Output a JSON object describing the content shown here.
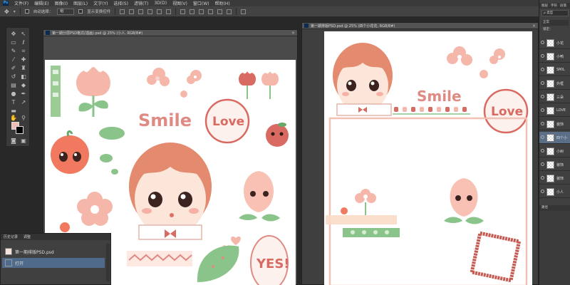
{
  "menubar": {
    "items": [
      "文件(F)",
      "编辑(E)",
      "图像(I)",
      "图层(L)",
      "文字(Y)",
      "选择(S)",
      "滤镜(T)",
      "3D(D)",
      "视图(V)",
      "窗口(W)",
      "帮助(H)"
    ]
  },
  "options": {
    "auto_select_label": "自动选择：",
    "auto_select_value": "组",
    "show_transform_label": "显示变换控件"
  },
  "doc_left": {
    "title": "第一期分层PSD格式(插画).psd @ 25% (小人, RGB/8#)",
    "smile": "Smile",
    "love": "Love",
    "yes": "YES!"
  },
  "doc_right": {
    "title": "第一期排版PSD.psd @ 25% (四个小花花, RGB/8#)",
    "smile": "Smile",
    "love": "Love"
  },
  "history": {
    "tabs": [
      "历史记录",
      "调整"
    ],
    "items": [
      "第一期排版PSD.psd",
      "打开"
    ]
  },
  "layers": {
    "tabs": [
      "图层",
      "字符",
      "段落"
    ],
    "filter_label": "ρ 类型",
    "blend_mode": "正常",
    "lock_label": "锁定：",
    "items": [
      {
        "name": "小花"
      },
      {
        "name": "小鸭"
      },
      {
        "name": "SMIL"
      },
      {
        "name": "外框"
      },
      {
        "name": "三朵"
      },
      {
        "name": "LOVE"
      },
      {
        "name": "装饰"
      },
      {
        "name": "四个小"
      },
      {
        "name": "小树"
      },
      {
        "name": "装饰"
      },
      {
        "name": "装饰"
      },
      {
        "name": "小人"
      }
    ],
    "footer_tab": "路径"
  },
  "colors": {
    "foreground": "#f0bcb4",
    "background": "#000000",
    "accent_pink": "#f3a99c",
    "accent_red": "#d96a62",
    "leaf_green": "#8bc48a"
  }
}
